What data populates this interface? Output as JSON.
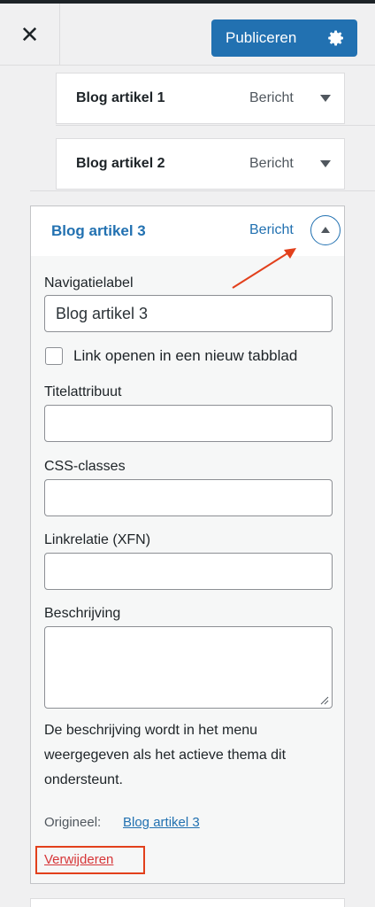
{
  "topbar": {
    "close_glyph": "✕",
    "publish_label": "Publiceren",
    "publish_color": "#2271b1"
  },
  "menu_items": [
    {
      "title": "Blog artikel 1",
      "type": "Bericht"
    },
    {
      "title": "Blog artikel 2",
      "type": "Bericht"
    }
  ],
  "expanded_item": {
    "title": "Blog artikel 3",
    "type": "Bericht",
    "nav_label_caption": "Navigatielabel",
    "nav_label_value": "Blog artikel 3",
    "new_tab_label": "Link openen in een nieuw tabblad",
    "title_attr_caption": "Titelattribuut",
    "title_attr_value": "",
    "css_classes_caption": "CSS-classes",
    "css_classes_value": "",
    "link_rel_caption": "Linkrelatie (XFN)",
    "link_rel_value": "",
    "description_caption": "Beschrijving",
    "description_value": "",
    "description_help": "De beschrijving wordt in het menu weergegeven als het actieve thema dit ondersteunt.",
    "original_label": "Origineel:",
    "original_link": "Blog artikel 3",
    "remove_label": "Verwijderen"
  },
  "icons": [
    "close-icon",
    "gear-icon",
    "chevron-down-icon",
    "chevron-up-icon",
    "annotation-arrow"
  ],
  "colors": {
    "accent": "#2271b1",
    "danger": "#d63638",
    "annotation": "#e2401c"
  }
}
